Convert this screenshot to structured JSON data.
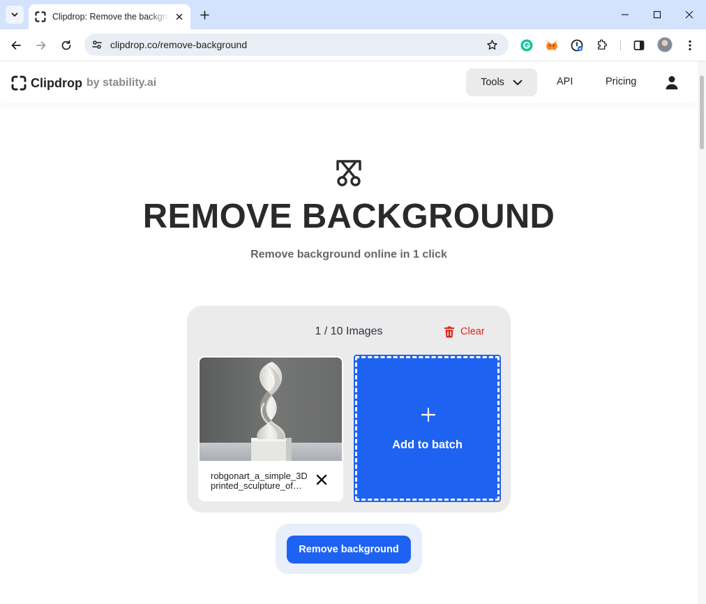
{
  "browser": {
    "tab": {
      "title": "Clipdrop: Remove the background from your images"
    },
    "address_bar": {
      "url": "clipdrop.co/remove-background"
    },
    "extensions": [
      "grammarly-icon",
      "metamask-icon",
      "password-manager-icon",
      "puzzle-icon"
    ]
  },
  "site": {
    "brand": {
      "name": "Clipdrop",
      "byline": "by stability.ai"
    },
    "nav": {
      "tools": "Tools",
      "api": "API",
      "pricing": "Pricing"
    }
  },
  "hero": {
    "icon": "scissors-frame-icon",
    "title": "REMOVE BACKGROUND",
    "subtitle": "Remove background online in 1 click"
  },
  "batch": {
    "count_label": "1 / 10 Images",
    "clear_label": "Clear",
    "items": [
      {
        "name_line1": "robgonart_a_simple_3D",
        "name_line2": "printed_sculpture_of_a_helix.png"
      }
    ],
    "add_label": "Add to batch"
  },
  "action": {
    "label": "Remove background"
  },
  "colors": {
    "accent": "#1e62f2",
    "danger": "#d9261c",
    "chrome": "#d3e3fd"
  }
}
